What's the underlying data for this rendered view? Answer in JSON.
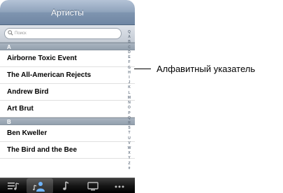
{
  "nav": {
    "title": "Артисты"
  },
  "search": {
    "placeholder": "Поиск"
  },
  "sections": [
    {
      "letter": "A",
      "items": [
        "Airborne Toxic Event",
        "The All-American Rejects",
        "Andrew Bird",
        "Art Brut"
      ]
    },
    {
      "letter": "B",
      "items": [
        "Ben Kweller",
        "The Bird and the Bee"
      ]
    }
  ],
  "index_letters": [
    "Q",
    "A",
    "B",
    "C",
    "D",
    "E",
    "F",
    "G",
    "H",
    "I",
    "J",
    "K",
    "L",
    "M",
    "N",
    "O",
    "P",
    "Q",
    "R",
    "S",
    "T",
    "U",
    "V",
    "W",
    "X",
    "Y",
    "Z",
    "#"
  ],
  "callout": {
    "label": "Алфавитный указатель"
  },
  "tabbar": {
    "tabs": [
      "playlists-icon",
      "artists-icon",
      "songs-icon",
      "videos-icon",
      "more-icon"
    ],
    "active": "artists-icon"
  }
}
